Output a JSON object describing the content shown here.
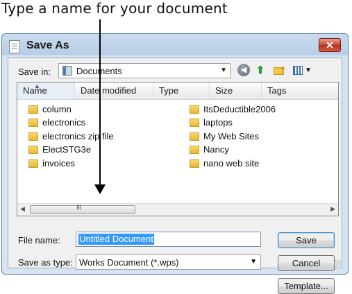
{
  "callout": {
    "text": "Type a name for your document"
  },
  "dialog": {
    "title": "Save As",
    "close_label": "✕",
    "save_in": {
      "label": "Save in:",
      "value": "Documents"
    },
    "toolbar": {
      "back_icon": "back-icon",
      "up_icon": "up-folder-icon",
      "new_folder_icon": "new-folder-icon",
      "views_icon": "views-menu-icon"
    },
    "columns": [
      "Name",
      "Date modified",
      "Type",
      "Size",
      "Tags"
    ],
    "items_left": [
      "column",
      "electronics",
      "electronics zip file",
      "ElectSTG3e",
      "invoices"
    ],
    "items_right": [
      "ItsDeductible2006",
      "laptops",
      "My Web Sites",
      "Nancy",
      "nano web site"
    ],
    "scroll_grip": "III",
    "file_name": {
      "label": "File name:",
      "value": "Untitled Document"
    },
    "save_as_type": {
      "label": "Save as type:",
      "value": "Works Document (*.wps)"
    },
    "buttons": {
      "save": "Save",
      "cancel": "Cancel",
      "template": "Template..."
    }
  }
}
